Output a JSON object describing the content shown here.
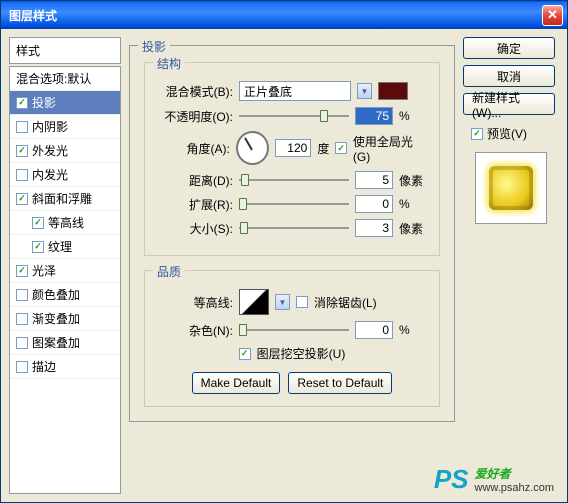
{
  "title": "图层样式",
  "left": {
    "header": "样式",
    "items": [
      {
        "label": "混合选项:默认",
        "checked": null,
        "sel": false,
        "indent": false
      },
      {
        "label": "投影",
        "checked": true,
        "sel": true,
        "indent": false
      },
      {
        "label": "内阴影",
        "checked": false,
        "sel": false,
        "indent": false
      },
      {
        "label": "外发光",
        "checked": true,
        "sel": false,
        "indent": false
      },
      {
        "label": "内发光",
        "checked": false,
        "sel": false,
        "indent": false
      },
      {
        "label": "斜面和浮雕",
        "checked": true,
        "sel": false,
        "indent": false
      },
      {
        "label": "等高线",
        "checked": true,
        "sel": false,
        "indent": true
      },
      {
        "label": "纹理",
        "checked": true,
        "sel": false,
        "indent": true
      },
      {
        "label": "光泽",
        "checked": true,
        "sel": false,
        "indent": false
      },
      {
        "label": "颜色叠加",
        "checked": false,
        "sel": false,
        "indent": false
      },
      {
        "label": "渐变叠加",
        "checked": false,
        "sel": false,
        "indent": false
      },
      {
        "label": "图案叠加",
        "checked": false,
        "sel": false,
        "indent": false
      },
      {
        "label": "描边",
        "checked": false,
        "sel": false,
        "indent": false
      }
    ]
  },
  "group": {
    "title": "投影",
    "structure": {
      "title": "结构",
      "blendModeLabel": "混合模式(B):",
      "blendModeValue": "正片叠底",
      "swatch": "#5a0c0c",
      "opacityLabel": "不透明度(O):",
      "opacityValue": "75",
      "opacityUnit": "%",
      "angleLabel": "角度(A):",
      "angleValue": "120",
      "angleUnit": "度",
      "globalLightLabel": "使用全局光(G)",
      "globalLightChecked": true,
      "distanceLabel": "距离(D):",
      "distanceValue": "5",
      "distanceUnit": "像素",
      "spreadLabel": "扩展(R):",
      "spreadValue": "0",
      "spreadUnit": "%",
      "sizeLabel": "大小(S):",
      "sizeValue": "3",
      "sizeUnit": "像素"
    },
    "quality": {
      "title": "品质",
      "contourLabel": "等高线:",
      "antiAliasLabel": "消除锯齿(L)",
      "antiAliasChecked": false,
      "noiseLabel": "杂色(N):",
      "noiseValue": "0",
      "noiseUnit": "%",
      "knockoutLabel": "图层挖空投影(U)",
      "knockoutChecked": true,
      "makeDefault": "Make Default",
      "resetDefault": "Reset to Default"
    }
  },
  "right": {
    "ok": "确定",
    "cancel": "取消",
    "newStyle": "新建样式(W)...",
    "previewLabel": "预览(V)",
    "previewChecked": true
  },
  "watermark": {
    "ps": "PS",
    "text": "爱好者",
    "url": "www.psahz.com"
  }
}
